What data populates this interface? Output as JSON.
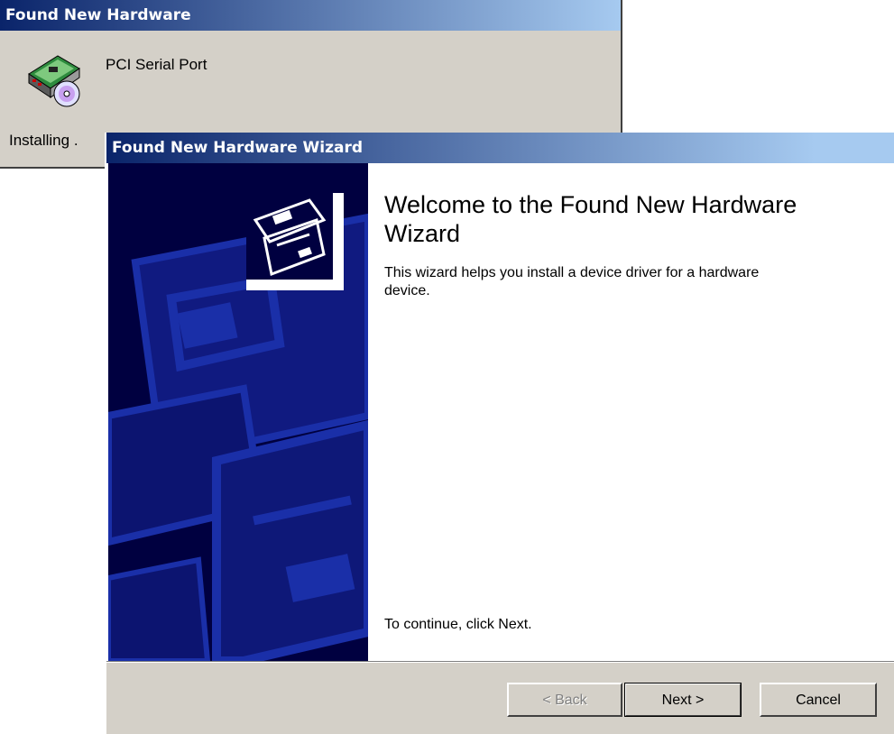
{
  "back_window": {
    "title": "Found New Hardware",
    "device_name": "PCI Serial Port",
    "status": "Installing .",
    "icon": "hardware-install-icon"
  },
  "wizard": {
    "title": "Found New Hardware Wizard",
    "heading": "Welcome to the Found New Hardware Wizard",
    "description": "This wizard helps you install a device driver for a hardware device.",
    "continue_text": "To continue, click Next.",
    "emblem_icon": "hardware-wizard-icon",
    "buttons": {
      "back": "< Back",
      "next": "Next >",
      "cancel": "Cancel"
    },
    "colors": {
      "title_bar": "#0a246a",
      "side_panel": "#000040",
      "side_art": "#1a2fa8",
      "face": "#d4d0c8"
    }
  }
}
